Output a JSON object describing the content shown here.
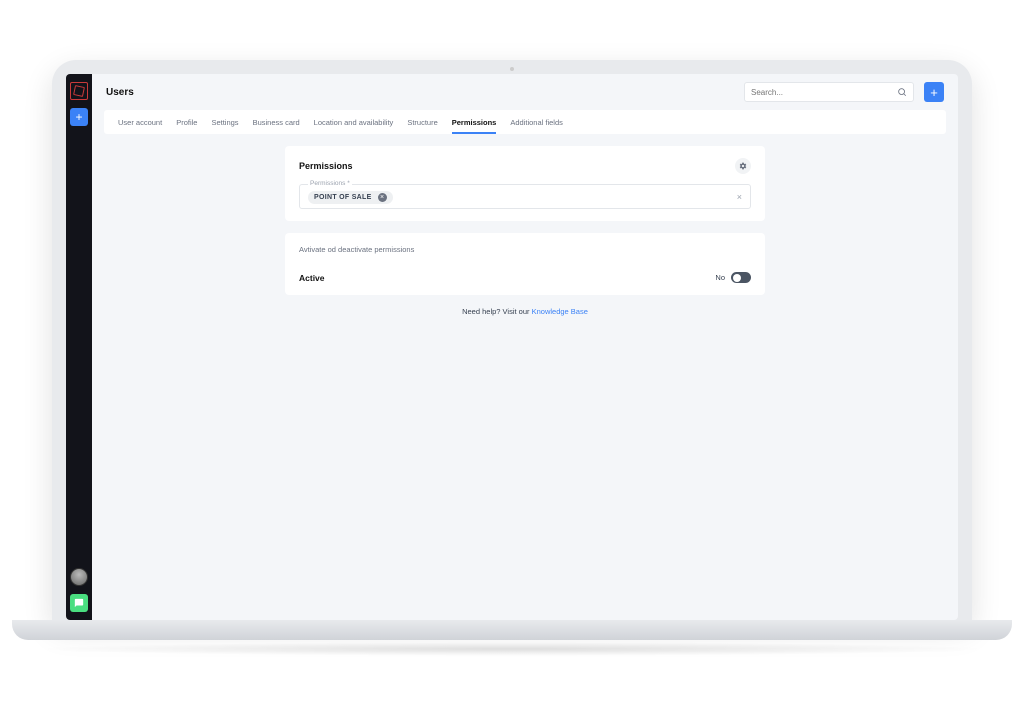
{
  "header": {
    "title": "Users",
    "search_placeholder": "Search..."
  },
  "tabs": [
    {
      "label": "User account",
      "active": false
    },
    {
      "label": "Profile",
      "active": false
    },
    {
      "label": "Settings",
      "active": false
    },
    {
      "label": "Business card",
      "active": false
    },
    {
      "label": "Location and availability",
      "active": false
    },
    {
      "label": "Structure",
      "active": false
    },
    {
      "label": "Permissions",
      "active": true
    },
    {
      "label": "Additional fields",
      "active": false
    }
  ],
  "permissions_card": {
    "title": "Permissions",
    "field_label": "Permissions *",
    "chip_label": "POINT OF SALE"
  },
  "activate_card": {
    "subtitle": "Avtivate od deactivate permissions",
    "row_label": "Active",
    "toggle_value": "No"
  },
  "footer": {
    "prefix": "Need help? Visit our ",
    "link": "Knowledge Base"
  }
}
